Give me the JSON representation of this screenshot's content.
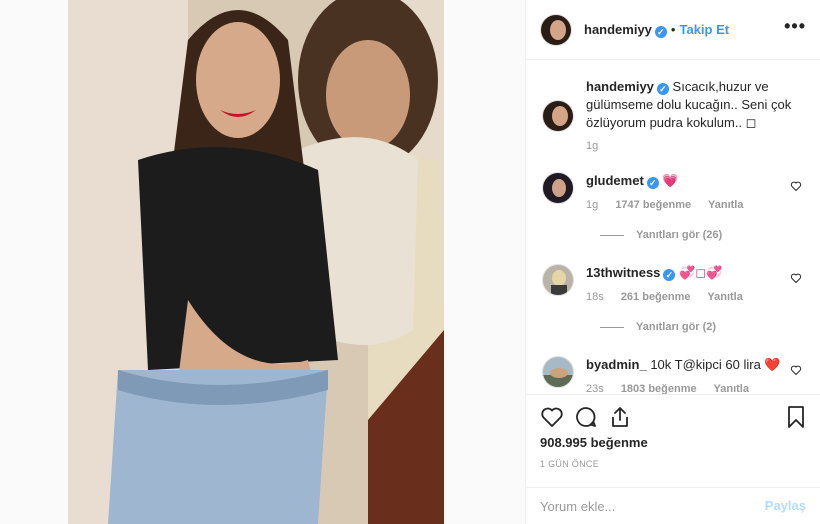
{
  "post": {
    "author": "handemiyy",
    "separator": "•",
    "follow_label": "Takip Et",
    "more_label": "•••"
  },
  "caption": {
    "author": "handemiyy",
    "text": "Sıcacık,huzur ve gülümseme dolu kucağın.. Seni çok özlüyorum pudra kokulum.. ◻",
    "time": "1g"
  },
  "comments": [
    {
      "user": "gludemet",
      "text": "💗",
      "time": "1g",
      "likes": "1747 beğenme",
      "reply_label": "Yanıtla",
      "view_replies": "Yanıtları gör (26)"
    },
    {
      "user": "13thwitness",
      "text": "💞◻💞",
      "time": "18s",
      "likes": "261 beğenme",
      "reply_label": "Yanıtla",
      "view_replies": "Yanıtları gör (2)"
    },
    {
      "user": "byadmin_",
      "text": "10k T@kipci 60 lira ❤️",
      "time": "23s",
      "likes": "1803 beğenme",
      "reply_label": "Yanıtla"
    }
  ],
  "footer": {
    "likes": "908.995 beğenme",
    "time": "1 GÜN ÖNCE",
    "comment_placeholder": "Yorum ekle...",
    "post_label": "Paylaş"
  },
  "colors": {
    "link_blue": "#3897f0",
    "post_disabled": "#b3dbff",
    "muted": "#999999"
  }
}
